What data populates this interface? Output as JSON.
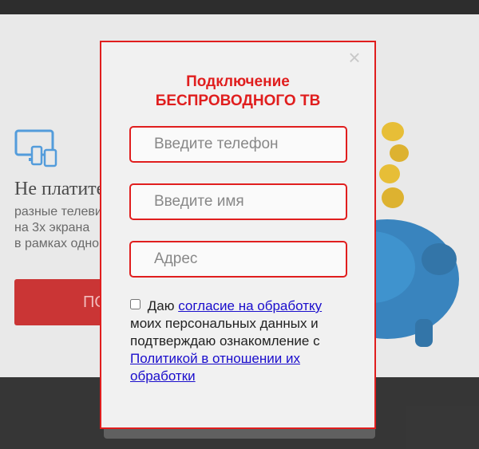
{
  "background": {
    "heading": "Не платите",
    "text_lines": [
      "разные телеви",
      "на 3х экрана",
      "в рамках одной"
    ],
    "button_label": "ПОД"
  },
  "modal": {
    "title_line1": "Подключение",
    "title_line2": "БЕСПРОВОДНОГО ТВ",
    "close_symbol": "×",
    "fields": [
      {
        "placeholder": "Введите телефон",
        "value": ""
      },
      {
        "placeholder": "Введите имя",
        "value": ""
      },
      {
        "placeholder": "Адрес",
        "value": ""
      }
    ],
    "consent": {
      "prefix": "Даю",
      "link1": "согласие на обработку",
      "middle": "моих персональных данных и подтверждаю ознакомление с",
      "link2": "Политикой в отношении их обработки",
      "checked": false
    }
  },
  "colors": {
    "accent": "#e01e1e",
    "link": "#1a0dcc",
    "modal_bg": "#f1f1f1"
  }
}
